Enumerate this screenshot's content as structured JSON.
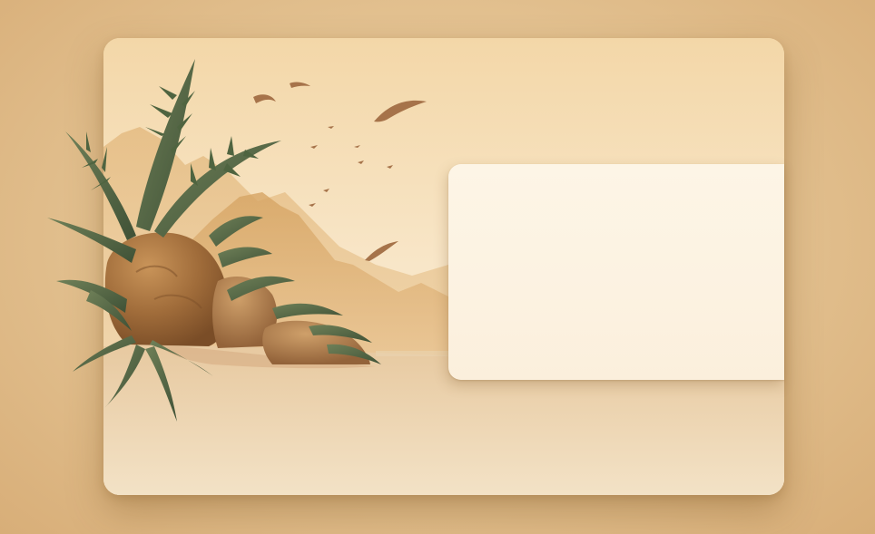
{
  "card": {
    "panel_text": ""
  },
  "scene": {
    "illustration_name": "tropical-desert-scene",
    "birds_count": 10
  },
  "colors": {
    "background": "#e2c08f",
    "card": "#f7ead2",
    "panel": "#fcf2e1",
    "foliage": "#5b6e4a",
    "rock": "#a0703f",
    "mountain": "#d9aa6b",
    "bird": "#a6734a"
  }
}
